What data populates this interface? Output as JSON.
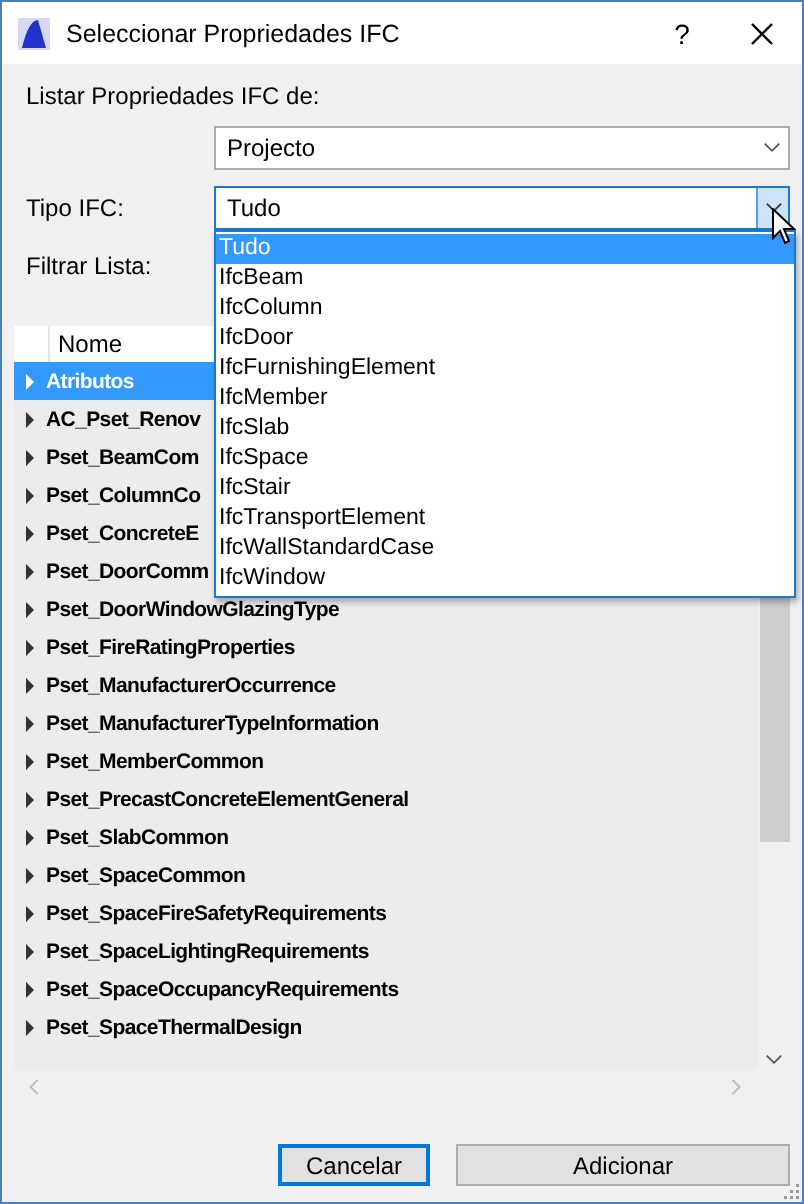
{
  "window": {
    "title": "Seleccionar Propriedades IFC",
    "help": "?"
  },
  "source": {
    "label": "Listar Propriedades IFC de:",
    "value": "Projecto"
  },
  "ifc_type": {
    "label": "Tipo IFC:",
    "value": "Tudo",
    "open": true,
    "options": [
      {
        "label": "Tudo",
        "selected": true
      },
      {
        "label": "IfcBeam",
        "selected": false
      },
      {
        "label": "IfcColumn",
        "selected": false
      },
      {
        "label": "IfcDoor",
        "selected": false
      },
      {
        "label": "IfcFurnishingElement",
        "selected": false
      },
      {
        "label": "IfcMember",
        "selected": false
      },
      {
        "label": "IfcSlab",
        "selected": false
      },
      {
        "label": "IfcSpace",
        "selected": false
      },
      {
        "label": "IfcStair",
        "selected": false
      },
      {
        "label": "IfcTransportElement",
        "selected": false
      },
      {
        "label": "IfcWallStandardCase",
        "selected": false
      },
      {
        "label": "IfcWindow",
        "selected": false
      }
    ]
  },
  "filter": {
    "label": "Filtrar Lista:"
  },
  "tree": {
    "columns": [
      "Nome"
    ],
    "rows": [
      {
        "label": "Atributos",
        "selected": true,
        "expanded": false
      },
      {
        "label": "AC_Pset_Renov",
        "selected": false,
        "expanded": false
      },
      {
        "label": "Pset_BeamCom",
        "selected": false,
        "expanded": false
      },
      {
        "label": "Pset_ColumnCo",
        "selected": false,
        "expanded": false
      },
      {
        "label": "Pset_ConcreteE",
        "selected": false,
        "expanded": false
      },
      {
        "label": "Pset_DoorComm",
        "selected": false,
        "expanded": false
      },
      {
        "label": "Pset_DoorWindowGlazingType",
        "selected": false,
        "expanded": false
      },
      {
        "label": "Pset_FireRatingProperties",
        "selected": false,
        "expanded": false
      },
      {
        "label": "Pset_ManufacturerOccurrence",
        "selected": false,
        "expanded": false
      },
      {
        "label": "Pset_ManufacturerTypeInformation",
        "selected": false,
        "expanded": false
      },
      {
        "label": "Pset_MemberCommon",
        "selected": false,
        "expanded": false
      },
      {
        "label": "Pset_PrecastConcreteElementGeneral",
        "selected": false,
        "expanded": false
      },
      {
        "label": "Pset_SlabCommon",
        "selected": false,
        "expanded": false
      },
      {
        "label": "Pset_SpaceCommon",
        "selected": false,
        "expanded": false
      },
      {
        "label": "Pset_SpaceFireSafetyRequirements",
        "selected": false,
        "expanded": false
      },
      {
        "label": "Pset_SpaceLightingRequirements",
        "selected": false,
        "expanded": false
      },
      {
        "label": "Pset_SpaceOccupancyRequirements",
        "selected": false,
        "expanded": false
      },
      {
        "label": "Pset_SpaceThermalDesign",
        "selected": false,
        "expanded": false
      }
    ]
  },
  "buttons": [
    {
      "label": "Cancelar",
      "focused": true
    },
    {
      "label": "Adicionar",
      "focused": false
    }
  ]
}
